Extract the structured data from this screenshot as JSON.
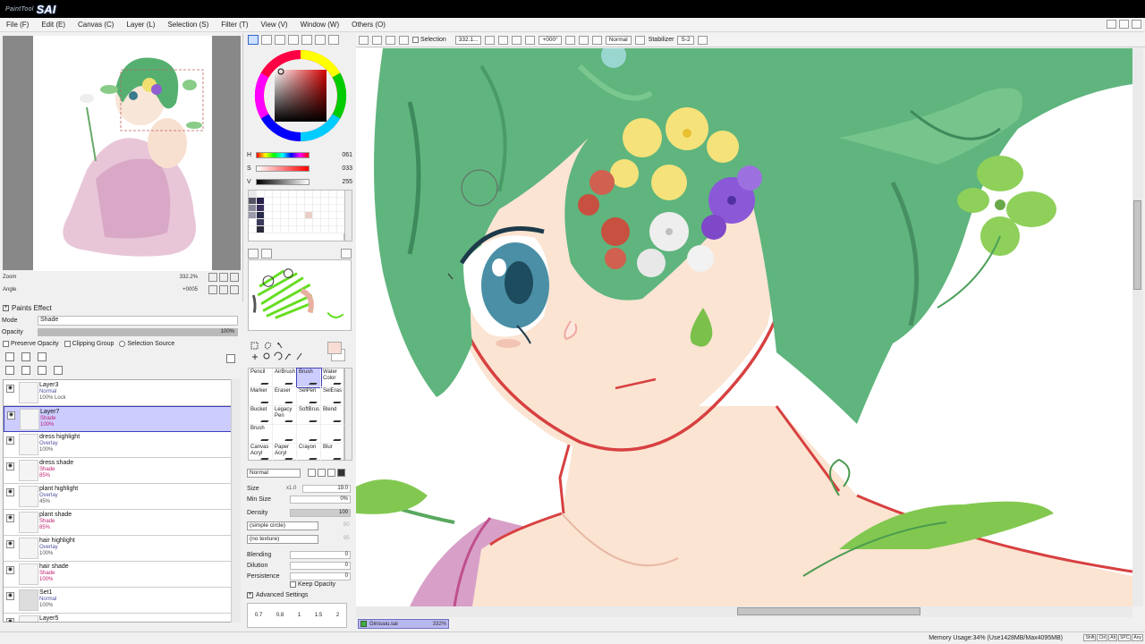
{
  "app": {
    "subtitle": "PaintTool",
    "name": "SAI"
  },
  "menu": [
    "File (F)",
    "Edit (E)",
    "Canvas (C)",
    "Layer (L)",
    "Selection (S)",
    "Filter (T)",
    "View (V)",
    "Window (W)",
    "Others (O)"
  ],
  "navigator": {
    "zoom_label": "Zoom",
    "zoom_value": "332.2%",
    "angle_label": "Angle",
    "angle_value": "+0005"
  },
  "paints_effect": {
    "title": "Paints Effect",
    "mode_label": "Mode",
    "mode_value": "Shade",
    "opacity_label": "Opacity",
    "opacity_value": "100%",
    "opacity_fraction": 1.0
  },
  "layer_options": {
    "preserve_opacity": "Preserve Opacity",
    "clipping_group": "Clipping Group",
    "selection_source": "Selection Source"
  },
  "layers": [
    {
      "name": "Layer3",
      "mode": "Normal",
      "opacity": "100% Lock",
      "selected": false,
      "shade": false
    },
    {
      "name": "Layer7",
      "mode": "Shade",
      "opacity": "100%",
      "selected": true,
      "shade": true
    },
    {
      "name": "dress highlight",
      "mode": "Overlay",
      "opacity": "100%",
      "selected": false,
      "shade": false
    },
    {
      "name": "dress shade",
      "mode": "Shade",
      "opacity": "85%",
      "selected": false,
      "shade": true
    },
    {
      "name": "plant highlight",
      "mode": "Overlay",
      "opacity": "45%",
      "selected": false,
      "shade": false
    },
    {
      "name": "plant shade",
      "mode": "Shade",
      "opacity": "85%",
      "selected": false,
      "shade": true
    },
    {
      "name": "hair highlight",
      "mode": "Overlay",
      "opacity": "100%",
      "selected": false,
      "shade": false
    },
    {
      "name": "hair shade",
      "mode": "Shade",
      "opacity": "100%",
      "selected": false,
      "shade": true
    },
    {
      "name": "Set1",
      "mode": "Normal",
      "opacity": "100%",
      "selected": false,
      "shade": false,
      "folder": true
    },
    {
      "name": "Layer5",
      "mode": "",
      "opacity": "",
      "selected": false,
      "shade": false
    }
  ],
  "color": {
    "h_label": "H",
    "h_value": "061",
    "s_label": "S",
    "s_value": "033",
    "v_label": "V",
    "v_value": "255",
    "swatches": [
      "#e8e8e8",
      "#ffffff",
      "#ffffff",
      "#ffffff",
      "#ffffff",
      "#ffffff",
      "#ffffff",
      "#ffffff",
      "#ffffff",
      "#ffffff",
      "#ffffff",
      "#ffffff",
      "#555566",
      "#2a1f4a",
      "#ffffff",
      "#ffffff",
      "#ffffff",
      "#ffffff",
      "#ffffff",
      "#ffffff",
      "#ffffff",
      "#ffffff",
      "#ffffff",
      "#ffffff",
      "#8a8a9a",
      "#3a2f5a",
      "#ffffff",
      "#ffffff",
      "#ffffff",
      "#ffffff",
      "#ffffff",
      "#ffffff",
      "#ffffff",
      "#ffffff",
      "#ffffff",
      "#ffffff",
      "#9a9aaa",
      "#2a2a4a",
      "#ffffff",
      "#ffffff",
      "#ffffff",
      "#ffffff",
      "#ffffff",
      "#e8d0c8",
      "#ffffff",
      "#ffffff",
      "#ffffff",
      "#ffffff",
      "#ffffff",
      "#3a3a5a",
      "#ffffff",
      "#ffffff",
      "#ffffff",
      "#ffffff",
      "#ffffff",
      "#ffffff",
      "#ffffff",
      "#ffffff",
      "#ffffff",
      "#ffffff",
      "#ffffff",
      "#2a2a3a",
      "#ffffff",
      "#ffffff",
      "#ffffff",
      "#ffffff",
      "#ffffff",
      "#ffffff",
      "#ffffff",
      "#ffffff",
      "#ffffff",
      "#ffffff"
    ],
    "fg": "#f7ddd4",
    "bg": "#ffffff"
  },
  "brushes": [
    {
      "name": "Pencil"
    },
    {
      "name": "AirBrush"
    },
    {
      "name": "Brush",
      "selected": true
    },
    {
      "name": "Water Color"
    },
    {
      "name": "Marker"
    },
    {
      "name": "Eraser"
    },
    {
      "name": "SelPen"
    },
    {
      "name": "SelEras"
    },
    {
      "name": "Bucket"
    },
    {
      "name": "Legacy Pen"
    },
    {
      "name": "SoftBrus"
    },
    {
      "name": "Blend"
    },
    {
      "name": "Brush"
    },
    {
      "name": ""
    },
    {
      "name": ""
    },
    {
      "name": ""
    },
    {
      "name": "Canvas Acryl"
    },
    {
      "name": "Paper Acryl"
    },
    {
      "name": "Crayon"
    },
    {
      "name": "Blur"
    }
  ],
  "brush_settings": {
    "blend_mode": "Normal",
    "size_label": "Size",
    "size_mult": "x1.0",
    "size_value": "19.0",
    "min_size_label": "Min Size",
    "min_size_value": "0%",
    "density_label": "Density",
    "density_value": "100",
    "shape": "(simple circle)",
    "shape_value": "50",
    "texture": "(no texture)",
    "texture_value": "95",
    "blending_label": "Blending",
    "blending_value": "0",
    "dilution_label": "Dilution",
    "dilution_value": "0",
    "persistence_label": "Persistence",
    "persistence_value": "0",
    "keep_opacity": "Keep Opacity",
    "advanced": "Advanced Settings",
    "presets": [
      "0.7",
      "0.8",
      "1",
      "1.5",
      "2"
    ]
  },
  "canvas_toolbar": {
    "selection_label": "Selection",
    "zoom": "332.1...",
    "angle": "+000°",
    "blend": "Normal",
    "stabilizer_label": "Stabilizer",
    "stabilizer_value": "S-2"
  },
  "document": {
    "name": "Ginsuuu.sai",
    "zoom": "332%"
  },
  "status": {
    "memory": "Memory Usage:34% (Use1428MB/Max4095MB)",
    "keys": [
      "Shift",
      "Ctrl",
      "Alt",
      "SPC",
      "Any"
    ]
  }
}
